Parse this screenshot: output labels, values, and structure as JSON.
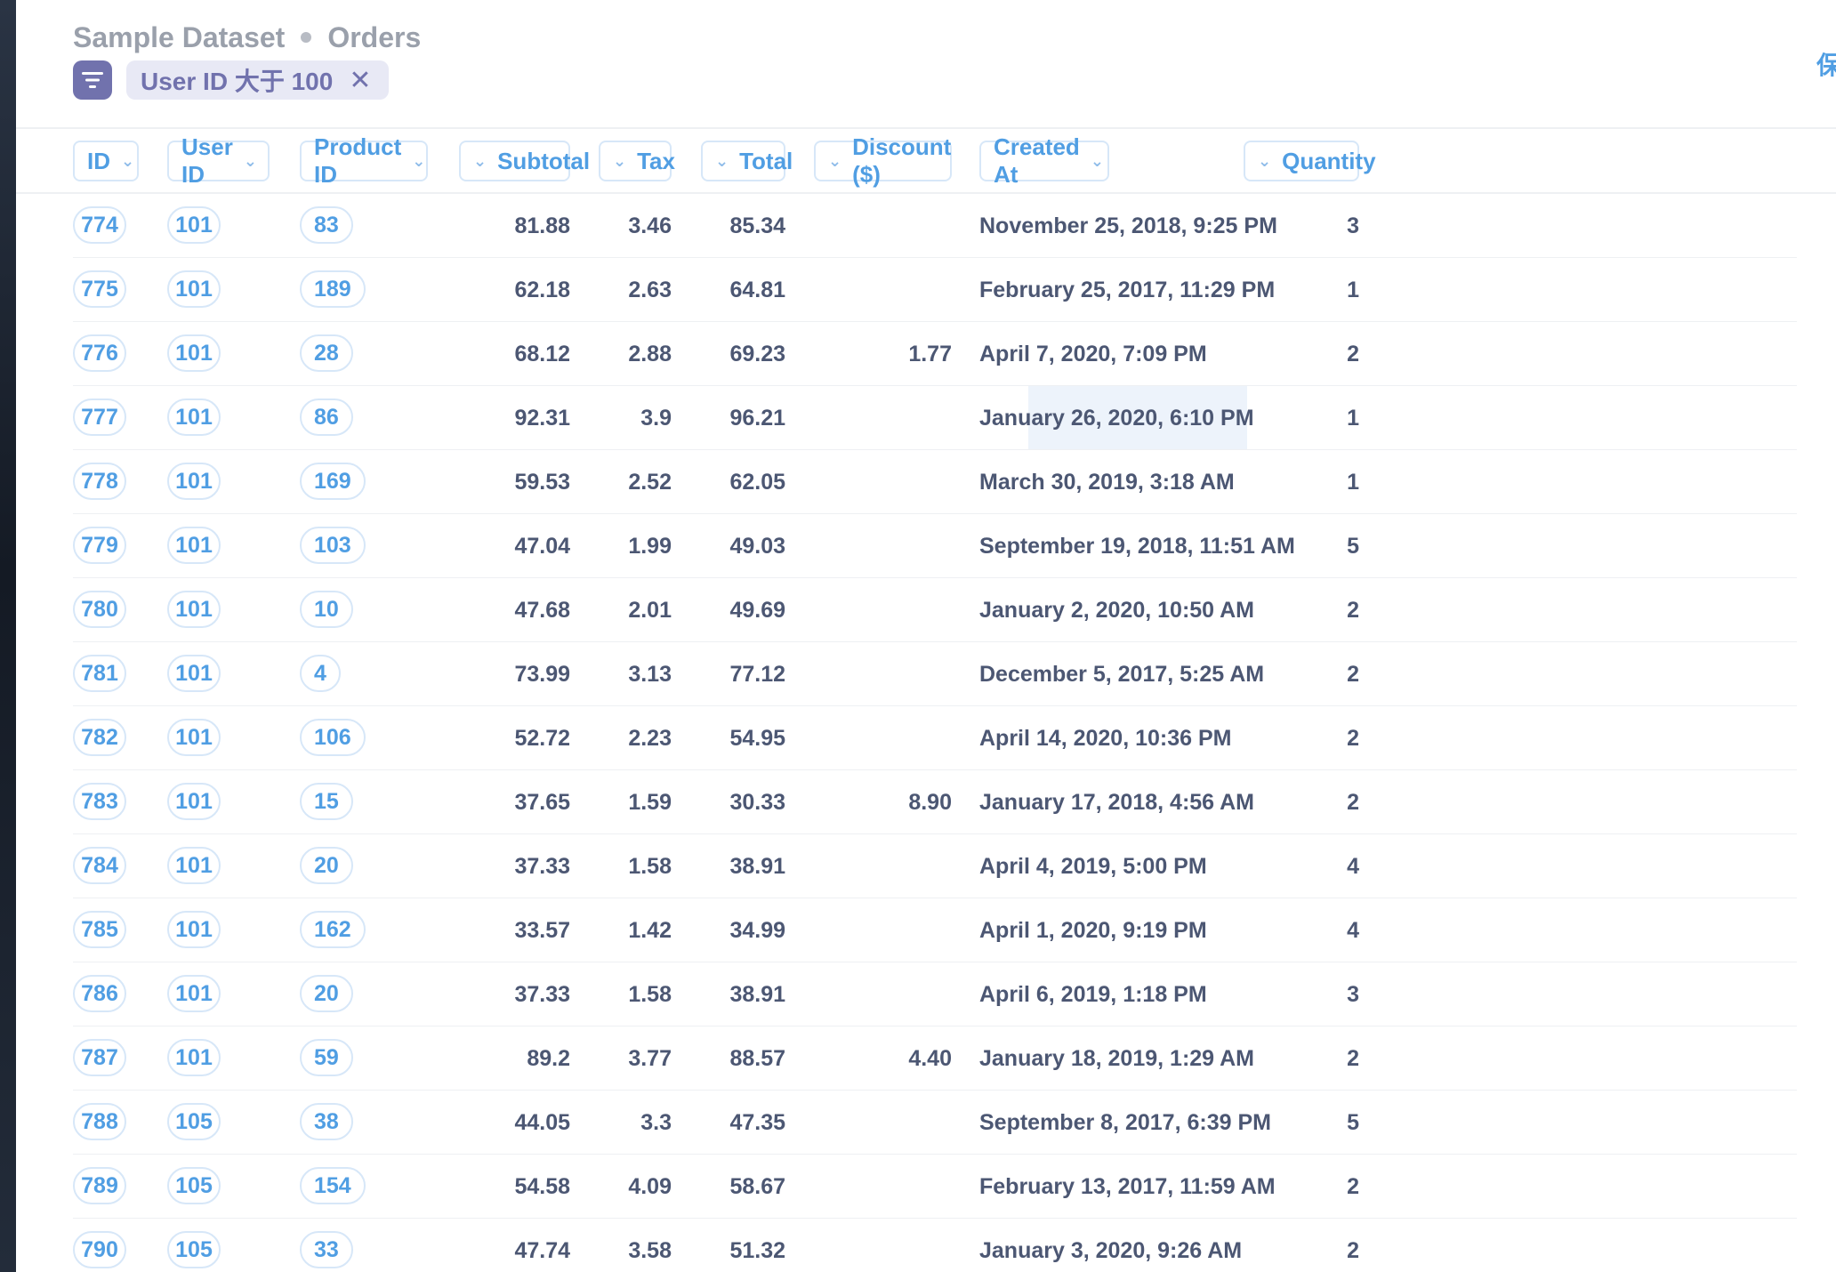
{
  "breadcrumb": {
    "database": "Sample Dataset",
    "table": "Orders"
  },
  "filter": {
    "icon": "filter-icon",
    "label": "User ID 大于 100",
    "remove_label": "✕"
  },
  "header_right": {
    "label": "保"
  },
  "colors": {
    "accent": "#509ee3",
    "filter": "#7172ad",
    "text": "#4c5773",
    "highlight": "#edf3fb"
  },
  "columns": [
    "ID",
    "User ID",
    "Product ID",
    "Subtotal",
    "Tax",
    "Total",
    "Discount ($)",
    "Created At",
    "Quantity"
  ],
  "rows": [
    {
      "id": "774",
      "user_id": "101",
      "product_id": "83",
      "subtotal": "81.88",
      "tax": "3.46",
      "total": "85.34",
      "discount": "",
      "created_at": "November 25, 2018, 9:25 PM",
      "quantity": "3"
    },
    {
      "id": "775",
      "user_id": "101",
      "product_id": "189",
      "subtotal": "62.18",
      "tax": "2.63",
      "total": "64.81",
      "discount": "",
      "created_at": "February 25, 2017, 11:29 PM",
      "quantity": "1"
    },
    {
      "id": "776",
      "user_id": "101",
      "product_id": "28",
      "subtotal": "68.12",
      "tax": "2.88",
      "total": "69.23",
      "discount": "1.77",
      "created_at": "April 7, 2020, 7:09 PM",
      "quantity": "2"
    },
    {
      "id": "777",
      "user_id": "101",
      "product_id": "86",
      "subtotal": "92.31",
      "tax": "3.9",
      "total": "96.21",
      "discount": "",
      "created_at": "January 26, 2020, 6:10 PM",
      "quantity": "1",
      "highlight_discount": true
    },
    {
      "id": "778",
      "user_id": "101",
      "product_id": "169",
      "subtotal": "59.53",
      "tax": "2.52",
      "total": "62.05",
      "discount": "",
      "created_at": "March 30, 2019, 3:18 AM",
      "quantity": "1"
    },
    {
      "id": "779",
      "user_id": "101",
      "product_id": "103",
      "subtotal": "47.04",
      "tax": "1.99",
      "total": "49.03",
      "discount": "",
      "created_at": "September 19, 2018, 11:51 AM",
      "quantity": "5"
    },
    {
      "id": "780",
      "user_id": "101",
      "product_id": "10",
      "subtotal": "47.68",
      "tax": "2.01",
      "total": "49.69",
      "discount": "",
      "created_at": "January 2, 2020, 10:50 AM",
      "quantity": "2"
    },
    {
      "id": "781",
      "user_id": "101",
      "product_id": "4",
      "subtotal": "73.99",
      "tax": "3.13",
      "total": "77.12",
      "discount": "",
      "created_at": "December 5, 2017, 5:25 AM",
      "quantity": "2"
    },
    {
      "id": "782",
      "user_id": "101",
      "product_id": "106",
      "subtotal": "52.72",
      "tax": "2.23",
      "total": "54.95",
      "discount": "",
      "created_at": "April 14, 2020, 10:36 PM",
      "quantity": "2"
    },
    {
      "id": "783",
      "user_id": "101",
      "product_id": "15",
      "subtotal": "37.65",
      "tax": "1.59",
      "total": "30.33",
      "discount": "8.90",
      "created_at": "January 17, 2018, 4:56 AM",
      "quantity": "2"
    },
    {
      "id": "784",
      "user_id": "101",
      "product_id": "20",
      "subtotal": "37.33",
      "tax": "1.58",
      "total": "38.91",
      "discount": "",
      "created_at": "April 4, 2019, 5:00 PM",
      "quantity": "4"
    },
    {
      "id": "785",
      "user_id": "101",
      "product_id": "162",
      "subtotal": "33.57",
      "tax": "1.42",
      "total": "34.99",
      "discount": "",
      "created_at": "April 1, 2020, 9:19 PM",
      "quantity": "4"
    },
    {
      "id": "786",
      "user_id": "101",
      "product_id": "20",
      "subtotal": "37.33",
      "tax": "1.58",
      "total": "38.91",
      "discount": "",
      "created_at": "April 6, 2019, 1:18 PM",
      "quantity": "3"
    },
    {
      "id": "787",
      "user_id": "101",
      "product_id": "59",
      "subtotal": "89.2",
      "tax": "3.77",
      "total": "88.57",
      "discount": "4.40",
      "created_at": "January 18, 2019, 1:29 AM",
      "quantity": "2"
    },
    {
      "id": "788",
      "user_id": "105",
      "product_id": "38",
      "subtotal": "44.05",
      "tax": "3.3",
      "total": "47.35",
      "discount": "",
      "created_at": "September 8, 2017, 6:39 PM",
      "quantity": "5"
    },
    {
      "id": "789",
      "user_id": "105",
      "product_id": "154",
      "subtotal": "54.58",
      "tax": "4.09",
      "total": "58.67",
      "discount": "",
      "created_at": "February 13, 2017, 11:59 AM",
      "quantity": "2"
    },
    {
      "id": "790",
      "user_id": "105",
      "product_id": "33",
      "subtotal": "47.74",
      "tax": "3.58",
      "total": "51.32",
      "discount": "",
      "created_at": "January 3, 2020, 9:26 AM",
      "quantity": "2"
    }
  ]
}
